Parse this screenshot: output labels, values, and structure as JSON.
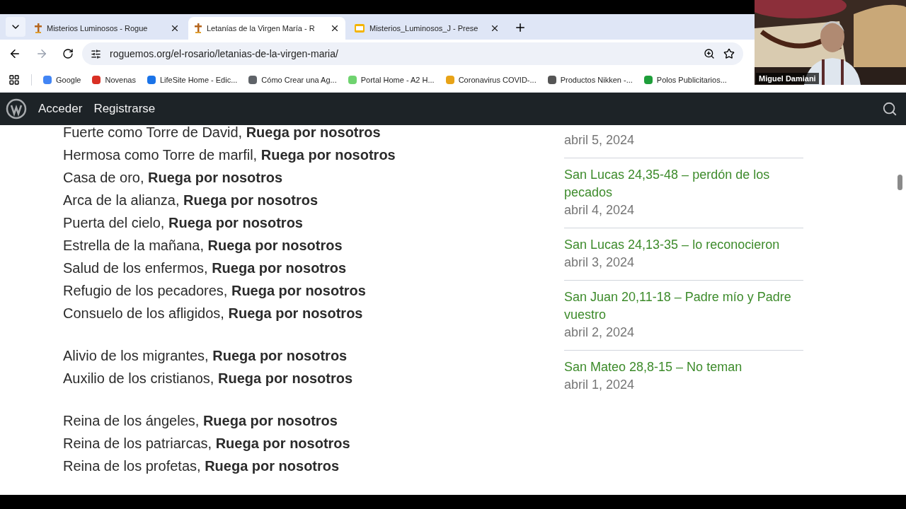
{
  "tabs": [
    {
      "title": "Misterios Luminosos - Rogue",
      "selected": false,
      "kind": "site"
    },
    {
      "title": "Letanías de la Virgen María - R",
      "selected": true,
      "kind": "site"
    },
    {
      "title": "Misterios_Luminosos_J - Prese",
      "selected": false,
      "kind": "slides"
    }
  ],
  "address": "roguemos.org/el-rosario/letanias-de-la-virgen-maria/",
  "bookmarks": [
    {
      "label": "Google",
      "color": "#4285f4"
    },
    {
      "label": "Novenas",
      "color": "#d93025"
    },
    {
      "label": "LifeSite Home - Edic...",
      "color": "#1a73e8"
    },
    {
      "label": "Cómo Crear una Ag...",
      "color": "#5f6368"
    },
    {
      "label": "Portal Home - A2 H...",
      "color": "#6fd36f"
    },
    {
      "label": "Coronavirus COVID-...",
      "color": "#e8a317"
    },
    {
      "label": "Productos Nikken -...",
      "color": "#555555"
    },
    {
      "label": "Polos Publicitarios...",
      "color": "#1e9e3a"
    }
  ],
  "admin_bar": {
    "links": [
      "Acceder",
      "Registrarse"
    ]
  },
  "litany_groups": [
    [
      {
        "text": "Fuerte como Torre de David,",
        "response": "Ruega por nosotros"
      },
      {
        "text": "Hermosa como Torre de marfil,",
        "response": "Ruega por nosotros"
      },
      {
        "text": "Casa de oro,",
        "response": "Ruega por nosotros"
      },
      {
        "text": "Arca de la alianza,",
        "response": "Ruega por nosotros"
      },
      {
        "text": "Puerta del cielo,",
        "response": "Ruega por nosotros"
      },
      {
        "text": "Estrella de la mañana,",
        "response": "Ruega por nosotros"
      },
      {
        "text": "Salud de los enfermos,",
        "response": "Ruega por nosotros"
      },
      {
        "text": "Refugio de los pecadores,",
        "response": "Ruega por nosotros"
      },
      {
        "text": "Consuelo de los afligidos,",
        "response": "Ruega por nosotros"
      }
    ],
    [
      {
        "text": "Alivio de los migrantes,",
        "response": "Ruega por nosotros"
      },
      {
        "text": "Auxilio de los cristianos,",
        "response": "Ruega por nosotros"
      }
    ],
    [
      {
        "text": "Reina de los ángeles,",
        "response": "Ruega por nosotros"
      },
      {
        "text": "Reina de los patriarcas,",
        "response": "Ruega por nosotros"
      },
      {
        "text": "Reina de los profetas,",
        "response": "Ruega por nosotros"
      }
    ]
  ],
  "recent_posts": [
    {
      "date": "abril 5, 2024"
    },
    {
      "title": "San Lucas 24,35-48 – perdón de los pecados",
      "date": "abril 4, 2024"
    },
    {
      "title": "San Lucas 24,13-35 – lo reconocieron",
      "date": "abril 3, 2024"
    },
    {
      "title": "San Juan 20,11-18 – Padre mío y Padre vuestro",
      "date": "abril 2, 2024"
    },
    {
      "title": "San Mateo 28,8-15 – No teman",
      "date": "abril 1, 2024"
    }
  ],
  "video_call": {
    "name": "Miguel Damiani"
  }
}
